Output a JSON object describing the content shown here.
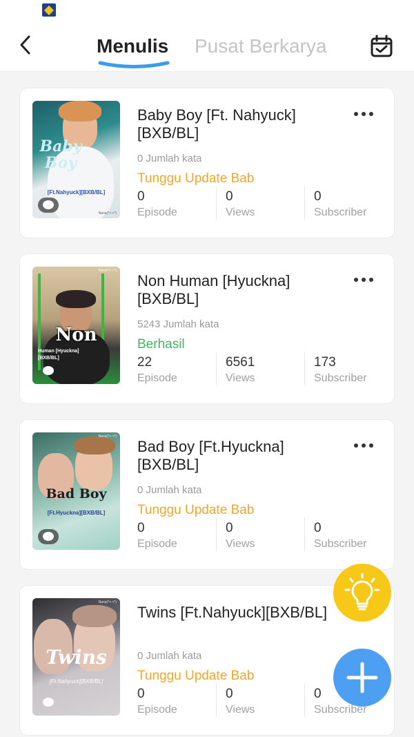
{
  "header": {
    "tabs": [
      {
        "label": "Menulis",
        "active": true
      },
      {
        "label": "Pusat Berkarya",
        "active": false
      }
    ]
  },
  "stat_labels": {
    "episode": "Episode",
    "views": "Views",
    "subscriber": "Subscriber"
  },
  "cover_watermark": "Nana(*>.<*)",
  "books": [
    {
      "title": "Baby Boy [Ft. Nahyuck][BXB/BL]",
      "cover_title": "Baby Boy",
      "cover_subtitle": "[Ft.Nahyuck][BXB/BL]",
      "word_count": "0 Jumlah kata",
      "status": "Tunggu Update Bab",
      "episode": "0",
      "views": "0",
      "subscriber": "0"
    },
    {
      "title": "Non Human [Hyuckna][BXB/BL]",
      "cover_title": "Non",
      "cover_subtitle": "Human [Hyuckna][BXB/BL]",
      "word_count": "5243 Jumlah kata",
      "status": "Berhasil",
      "episode": "22",
      "views": "6561",
      "subscriber": "173"
    },
    {
      "title": "Bad Boy [Ft.Hyuckna][BXB/BL]",
      "cover_title": "Bad Boy",
      "cover_subtitle": "[Ft.Hyuckna][BXB/BL]",
      "word_count": "0 Jumlah kata",
      "status": "Tunggu Update Bab",
      "episode": "0",
      "views": "0",
      "subscriber": "0"
    },
    {
      "title": "Twins [Ft.Nahyuck][BXB/BL]",
      "cover_title": "Twins",
      "cover_subtitle": "[Ft.Nahyuck][BXB/BL]",
      "word_count": "0 Jumlah kata",
      "status": "Tunggu Update Bab",
      "episode": "0",
      "views": "0",
      "subscriber": "0"
    }
  ],
  "colors": {
    "status_waiting": "#f5a623",
    "status_success": "#3cb95f",
    "fab_idea": "#f7c817",
    "fab_add": "#4d9ff2",
    "tab_underline": "#3d9be9"
  },
  "icons": {
    "back": "chevron-left-icon",
    "calendar": "calendar-check-icon",
    "more": "more-horizontal-icon",
    "comment": "comment-bubble-icon",
    "idea": "lightbulb-icon",
    "add": "plus-icon"
  }
}
